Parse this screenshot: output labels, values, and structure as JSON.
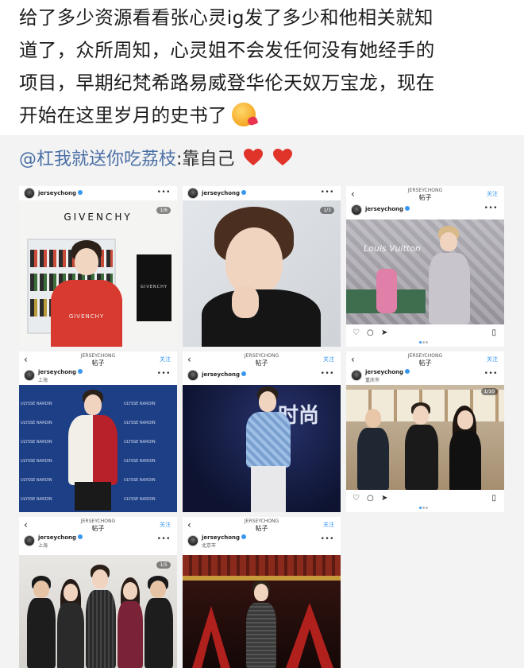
{
  "post": {
    "lines": [
      "给了多少资源看看张心灵ig发了多少和他相关就知",
      "道了，众所周知，心灵姐不会发任何没有她经手的",
      "项目，早期纪梵希路易威登华伦天奴万宝龙，现在",
      "开始在这里岁月的史书了"
    ],
    "emoji": "smiling-face-with-heart-icon"
  },
  "repost": {
    "mention": "@杠我就送你吃荔枝",
    "text": ":靠自己",
    "hearts": 2
  },
  "colors": {
    "link": "#4a6fa5",
    "instagram_blue": "#3897f0",
    "heart_red": "#e0342a",
    "panel_bg": "#f3f3f3"
  },
  "cards": [
    {
      "handle": "jerseychong",
      "more": "•••",
      "badge": "1/6",
      "brand_text": "GIVENCHY",
      "jacket_text": "GIVENCHY",
      "box_text": "GIVENCHY"
    },
    {
      "handle": "jerseychong",
      "more": "•••",
      "badge": "1/3"
    },
    {
      "nav_title": "JERSEYCHONG",
      "nav_sub": "帖子",
      "follow": "关注",
      "handle": "jerseychong",
      "more": "•••",
      "brand_text": "Louis Vuitton"
    },
    {
      "nav_title": "JERSEYCHONG",
      "nav_sub": "帖子",
      "follow": "关注",
      "handle": "jerseychong",
      "location": "上海",
      "more": "•••",
      "brand_text": "ULYSSE NARDIN"
    },
    {
      "nav_title": "JERSEYCHONG",
      "nav_sub": "帖子",
      "follow": "关注",
      "handle": "jerseychong",
      "more": "•••",
      "brand_text": "时尚"
    },
    {
      "nav_title": "JERSEYCHONG",
      "nav_sub": "帖子",
      "follow": "关注",
      "handle": "jerseychong",
      "location": "重庆市",
      "more": "•••",
      "badge": "1/10"
    },
    {
      "nav_title": "JERSEYCHONG",
      "nav_sub": "帖子",
      "follow": "关注",
      "handle": "jerseychong",
      "location": "上海",
      "more": "•••",
      "badge": "1/5"
    },
    {
      "nav_title": "JERSEYCHONG",
      "nav_sub": "帖子",
      "follow": "关注",
      "handle": "jerseychong",
      "location": "北京市",
      "more": "•••"
    }
  ]
}
